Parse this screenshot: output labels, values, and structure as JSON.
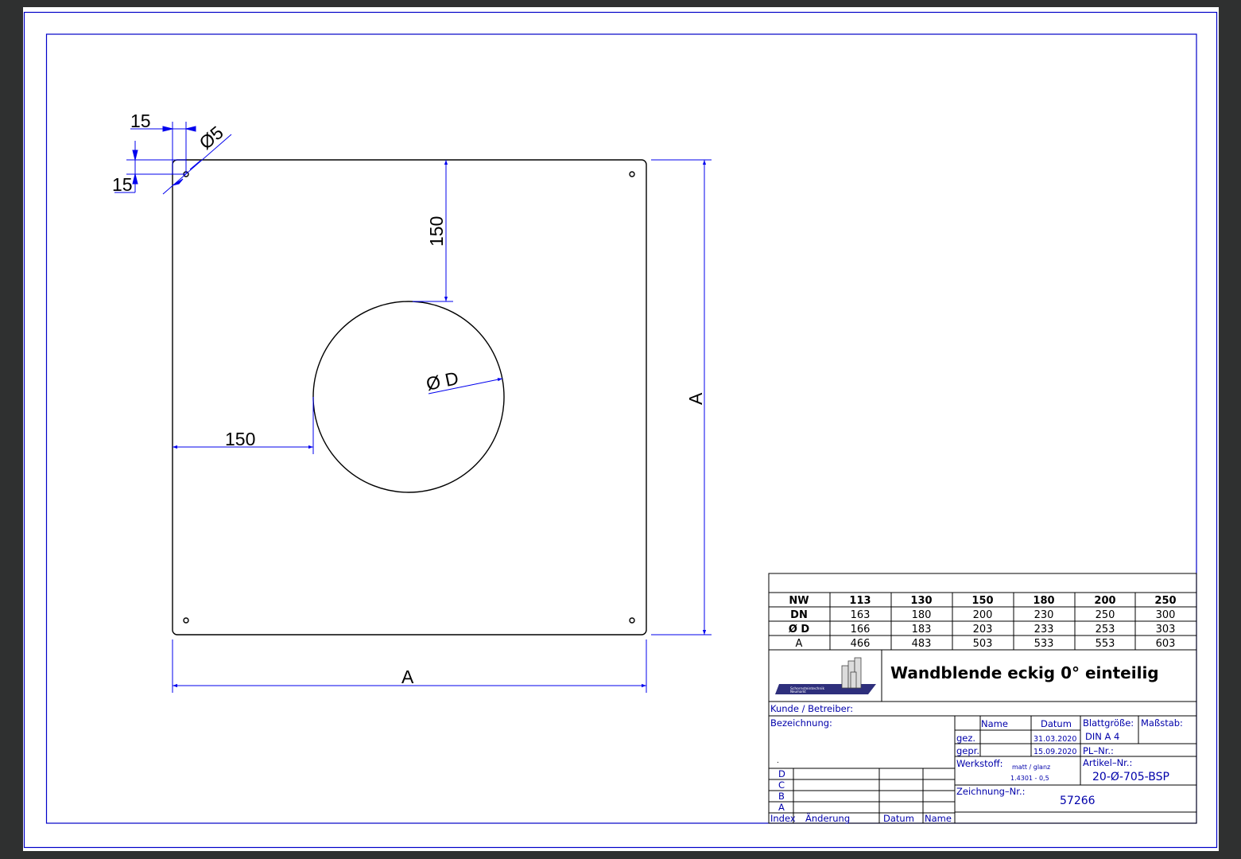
{
  "drawing": {
    "hole_dia_label": "Ø5",
    "offset_x_label": "15",
    "offset_y_label": "15",
    "dist_top_label": "150",
    "dist_left_label": "150",
    "circle_dia_label": "Ø D",
    "side_a_label": "A"
  },
  "spec_table": {
    "rows": [
      {
        "label": "NW",
        "values": [
          "113",
          "130",
          "150",
          "180",
          "200",
          "250"
        ]
      },
      {
        "label": "DN",
        "values": [
          "163",
          "180",
          "200",
          "230",
          "250",
          "300"
        ]
      },
      {
        "label": "Ø D",
        "values": [
          "166",
          "183",
          "203",
          "233",
          "253",
          "303"
        ]
      },
      {
        "label": "A",
        "values": [
          "466",
          "483",
          "503",
          "533",
          "553",
          "603"
        ]
      }
    ]
  },
  "title_block": {
    "logo_text_1": "Schornsteintechnik",
    "logo_text_2": "Neumarkt",
    "title": "Wandblende eckig 0° einteilig",
    "customer_label": "Kunde / Betreiber:",
    "designation_label": "Bezeichnung:",
    "designation_mark": ".",
    "name_header": "Name",
    "date_header": "Datum",
    "sheet_size_label": "Blattgröße:",
    "sheet_size_value": "DIN A 4",
    "scale_label": "Maßstab:",
    "drawn_label": "gez.",
    "drawn_date": "31.03.2020",
    "checked_label": "gepr.",
    "checked_date": "15.09.2020",
    "pl_label": "PL–Nr.:",
    "material_label": "Werkstoff:",
    "material_value_1": "matt / glanz",
    "material_value_2": "1.4301 - 0,5",
    "article_label": "Artikel–Nr.:",
    "article_value": "20-Ø-705-BSP",
    "drawing_no_label": "Zeichnung–Nr.:",
    "drawing_no_value": "57266",
    "revisions": [
      "D",
      "C",
      "B",
      "A"
    ],
    "index_header": "Index",
    "change_header": "Änderung",
    "rev_date_header": "Datum",
    "rev_name_header": "Name"
  },
  "colors": {
    "dimension": "#0000ee",
    "outline": "#000000",
    "border": "#0000c8",
    "viewer_bg": "#2f3030"
  }
}
